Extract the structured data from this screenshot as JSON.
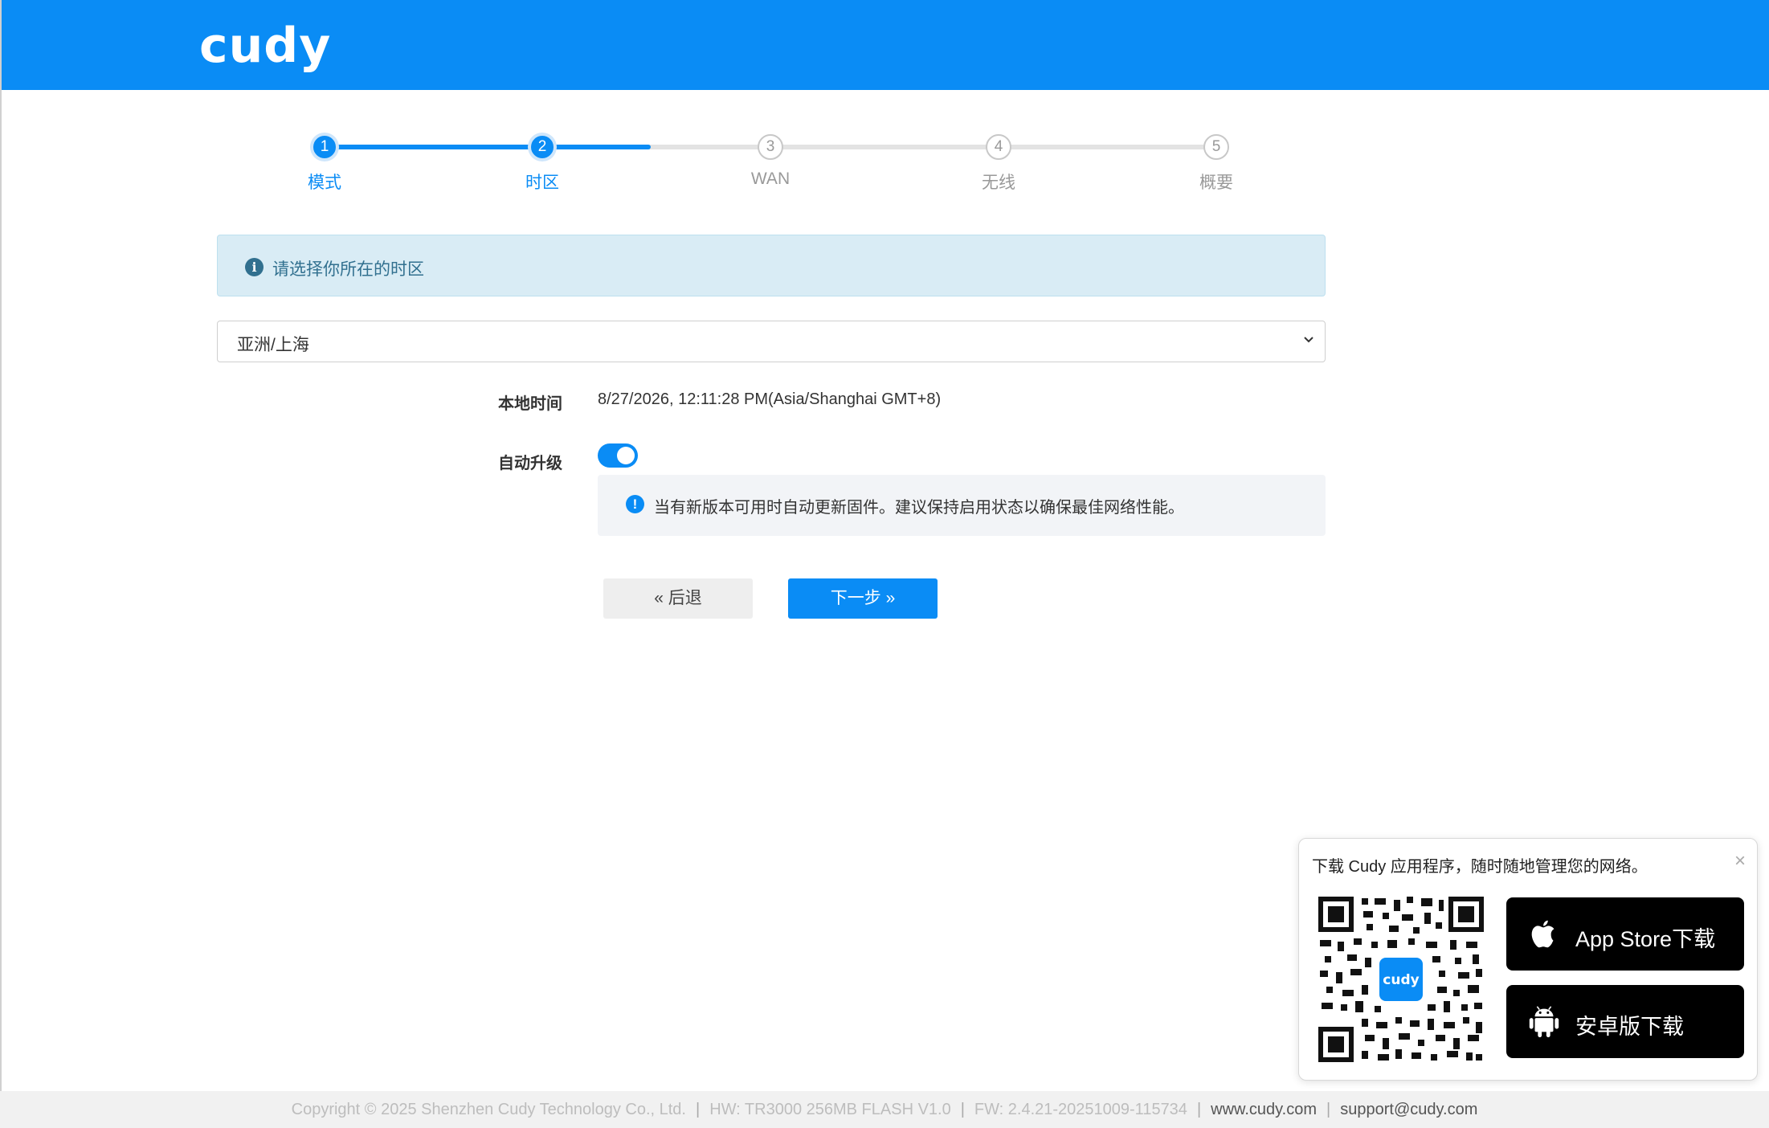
{
  "brand": {
    "logo_text": "cudy"
  },
  "stepper": {
    "steps": [
      {
        "num": "1",
        "label": "模式"
      },
      {
        "num": "2",
        "label": "时区"
      },
      {
        "num": "3",
        "label": "WAN"
      },
      {
        "num": "4",
        "label": "无线"
      },
      {
        "num": "5",
        "label": "概要"
      }
    ],
    "current_step": 2
  },
  "info": {
    "text": "请选择你所在的时区"
  },
  "timezone_select": {
    "value": "亚洲/上海"
  },
  "local_time": {
    "label": "本地时间",
    "value": "8/27/2026, 12:11:28 PM(Asia/Shanghai GMT+8)"
  },
  "auto_upgrade": {
    "label": "自动升级",
    "enabled": true,
    "note": "当有新版本可用时自动更新固件。建议保持启用状态以确保最佳网络性能。"
  },
  "buttons": {
    "back": "« 后退",
    "next": "下一步 »"
  },
  "app_popup": {
    "title": "下载 Cudy 应用程序，随时随地管理您的网络。",
    "close": "×",
    "qr_logo": "cudy",
    "app_store": "App Store下载",
    "android": "安卓版下载"
  },
  "footer": {
    "copyright": "Copyright © 2025 Shenzhen Cudy Technology Co., Ltd.",
    "hw": "HW: TR3000 256MB FLASH V1.0",
    "fw": "FW: 2.4.21-20251009-115734",
    "website": "www.cudy.com",
    "email": "support@cudy.com"
  },
  "colors": {
    "primary": "#0a8cf5",
    "info_bg": "#d9ecf5",
    "info_text": "#31708f"
  }
}
